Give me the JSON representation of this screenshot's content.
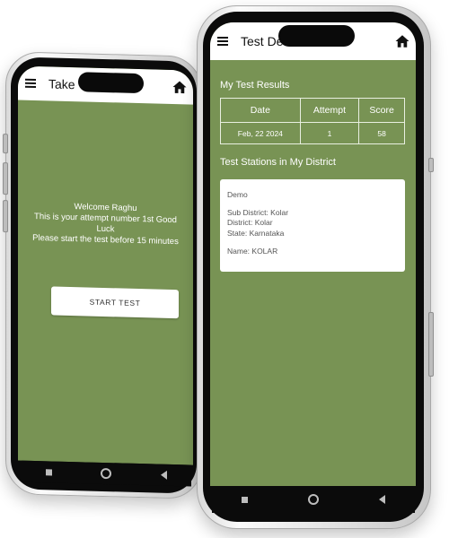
{
  "left_phone": {
    "appbar": {
      "title": "Take T"
    },
    "welcome": {
      "line1": "Welcome Raghu",
      "line2": "This is your attempt number 1st Good",
      "line3": "Luck",
      "line4": "Please start the test before 15  minutes"
    },
    "start_button": "START TEST"
  },
  "right_phone": {
    "appbar": {
      "title": "Test De"
    },
    "results_title": "My Test Results",
    "results_table": {
      "headers": [
        "Date",
        "Attempt",
        "Score"
      ],
      "rows": [
        [
          "Feb, 22 2024",
          "1",
          "58"
        ]
      ]
    },
    "stations_title": "Test Stations in My District",
    "station": {
      "name": "Demo",
      "sub_district": "Sub District: Kolar",
      "district": "District: Kolar",
      "state": "State: Karnataka",
      "label_name": "Name: KOLAR"
    }
  },
  "colors": {
    "screen_bg": "#789354",
    "appbar_bg": "#ffffff",
    "card_bg": "#ffffff"
  },
  "icons": [
    "menu-icon",
    "home-icon",
    "nav-recents-icon",
    "nav-home-icon",
    "nav-back-icon"
  ]
}
